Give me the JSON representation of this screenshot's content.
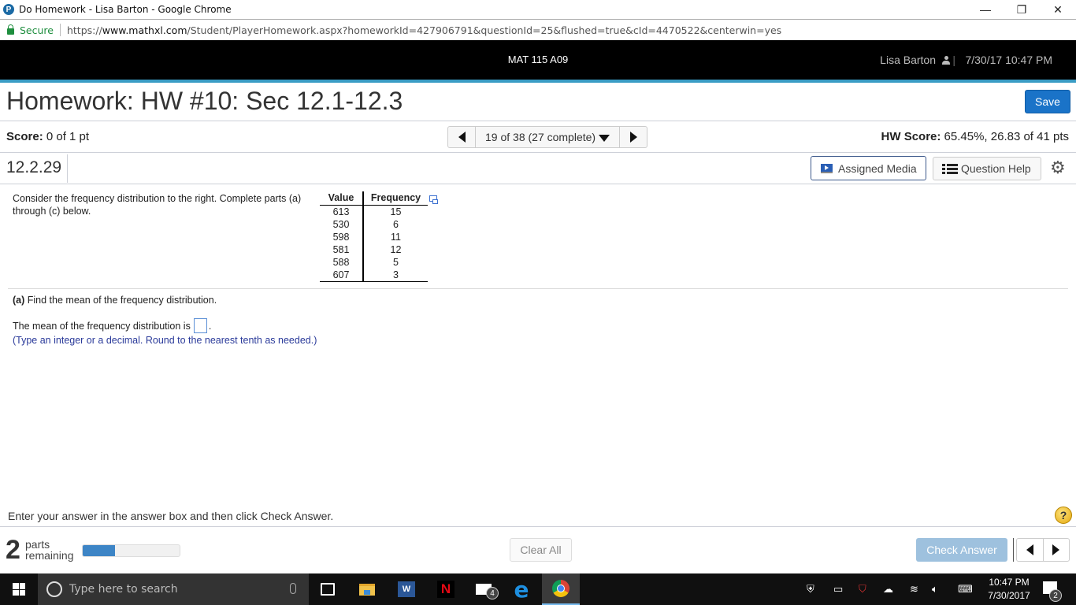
{
  "browser": {
    "window_title": "Do Homework - Lisa Barton - Google Chrome",
    "secure_label": "Secure",
    "url_prefix": "https://",
    "url_domain": "www.mathxl.com",
    "url_path": "/Student/PlayerHomework.aspx?homeworkId=427906791&questionId=25&flushed=true&cId=4470522&centerwin=yes",
    "controls": {
      "minimize": "—",
      "restore": "❐",
      "close": "✕"
    }
  },
  "header": {
    "course": "MAT 115 A09",
    "user_name": "Lisa Barton",
    "divider": "|",
    "datetime": "7/30/17 10:47 PM"
  },
  "homework": {
    "title": "Homework: HW #10: Sec 12.1-12.3",
    "save_label": "Save",
    "score_label": "Score:",
    "score_value": "0 of 1 pt",
    "nav_label": "19 of 38 (27 complete)",
    "hw_score_label": "HW Score:",
    "hw_score_value": "65.45%, 26.83 of 41 pts",
    "question_id": "12.2.29",
    "assigned_media_label": "Assigned Media",
    "question_help_label": "Question Help"
  },
  "question": {
    "intro": "Consider the frequency distribution to the right. Complete parts (a) through (c) below.",
    "table": {
      "headers": [
        "Value",
        "Frequency"
      ],
      "rows": [
        [
          "613",
          "15"
        ],
        [
          "530",
          "6"
        ],
        [
          "598",
          "11"
        ],
        [
          "581",
          "12"
        ],
        [
          "588",
          "5"
        ],
        [
          "607",
          "3"
        ]
      ]
    },
    "part_a_label": "(a)",
    "part_a_text": "Find the mean of the frequency distribution.",
    "mean_prefix": "The mean of the frequency distribution is",
    "mean_suffix": ".",
    "answer_value": "",
    "hint": "(Type an integer or a decimal. Round to the nearest tenth as needed.)"
  },
  "footer": {
    "instruction": "Enter your answer in the answer box and then click Check Answer.",
    "help_symbol": "?",
    "parts_remaining_count": "2",
    "parts_label_1": "parts",
    "parts_label_2": "remaining",
    "progress_fraction": 0.33,
    "clear_all_label": "Clear All",
    "check_answer_label": "Check Answer"
  },
  "taskbar": {
    "search_placeholder": "Type here to search",
    "word_label": "W",
    "netflix_label": "N",
    "mail_badge": "4",
    "edge_label": "e",
    "clock_time": "10:47 PM",
    "clock_date": "7/30/2017",
    "notification_badge": "2"
  }
}
